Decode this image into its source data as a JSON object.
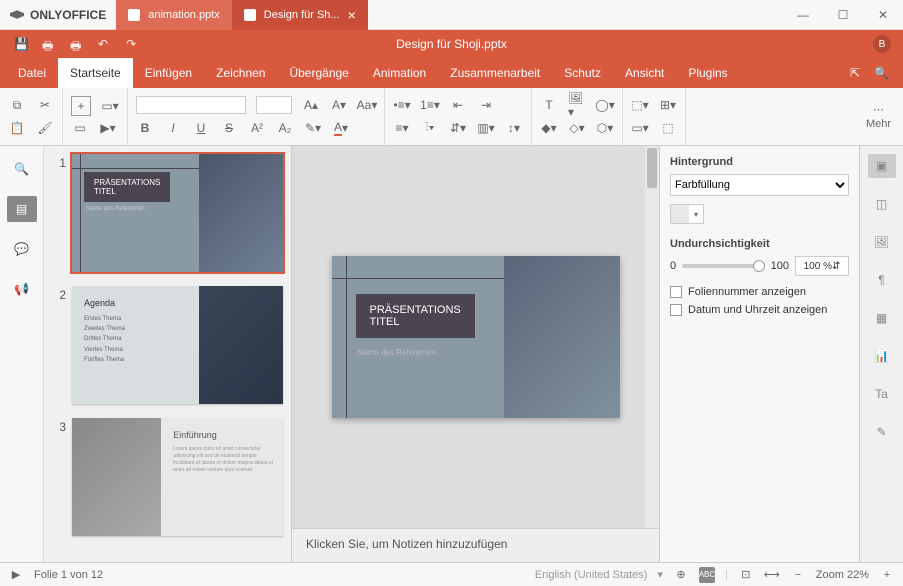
{
  "app": {
    "name": "ONLYOFFICE",
    "user_initial": "B"
  },
  "tabs": [
    {
      "label": "animation.pptx",
      "active": false
    },
    {
      "label": "Design für Sh...",
      "active": true
    }
  ],
  "document_title": "Design für Shoji.pptx",
  "menu": {
    "items": [
      "Datei",
      "Startseite",
      "Einfügen",
      "Zeichnen",
      "Übergänge",
      "Animation",
      "Zusammenarbeit",
      "Schutz",
      "Ansicht",
      "Plugins"
    ],
    "active": "Startseite"
  },
  "toolbar": {
    "more_label": "Mehr"
  },
  "slides": [
    {
      "num": 1,
      "title": "PRÄSENTATIONS\nTITEL",
      "subtitle": "Name des Referenten",
      "selected": true
    },
    {
      "num": 2,
      "title": "Agenda",
      "items": [
        "Erstes Thema",
        "Zweites Thema",
        "Drittes Thema",
        "Viertes Thema",
        "Fünftes Thema"
      ],
      "selected": false
    },
    {
      "num": 3,
      "title": "Einführung",
      "selected": false
    }
  ],
  "canvas": {
    "title": "PRÄSENTATIONS\nTITEL",
    "subtitle": "Name des Referenten"
  },
  "notes_placeholder": "Klicken Sie, um Notizen hinzuzufügen",
  "props": {
    "bg_label": "Hintergrund",
    "fill_type": "Farbfüllung",
    "opacity_label": "Undurchsichtigkeit",
    "opacity_min": "0",
    "opacity_max": "100",
    "opacity_value": "100 %",
    "show_slidenum": "Foliennummer anzeigen",
    "show_datetime": "Datum und Uhrzeit anzeigen"
  },
  "status": {
    "slide_info": "Folie 1 von 12",
    "language": "English (United States)",
    "zoom_label": "Zoom 22%"
  }
}
